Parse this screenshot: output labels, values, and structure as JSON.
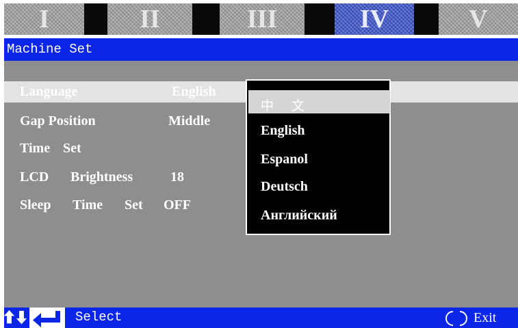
{
  "tabs": [
    {
      "label": "I",
      "active": false
    },
    {
      "label": "II",
      "active": false
    },
    {
      "label": "III",
      "active": false
    },
    {
      "label": "IV",
      "active": true
    },
    {
      "label": "V",
      "active": false
    }
  ],
  "title": "Machine Set",
  "menu": {
    "language_label": "Language",
    "language_value": "English",
    "gap_label": "Gap Position",
    "gap_value": "Middle",
    "time_label_1": "Time",
    "time_label_2": "Set",
    "lcd_label_1": "LCD",
    "lcd_label_2": "Brightness",
    "lcd_value": "18",
    "sleep_label_1": "Sleep",
    "sleep_label_2": "Time",
    "sleep_label_3": "Set",
    "sleep_value": "OFF"
  },
  "dropdown": {
    "options": [
      "中 文",
      "English",
      "Espanol",
      "Deutsch",
      "Английский"
    ],
    "selected_index": 0
  },
  "footer": {
    "select_label": "Select",
    "exit_label": "Exit"
  },
  "colors": {
    "accent_blue": "#0b26e6",
    "content_gray": "#8e8e8e",
    "highlight": "#e3e3e3"
  }
}
